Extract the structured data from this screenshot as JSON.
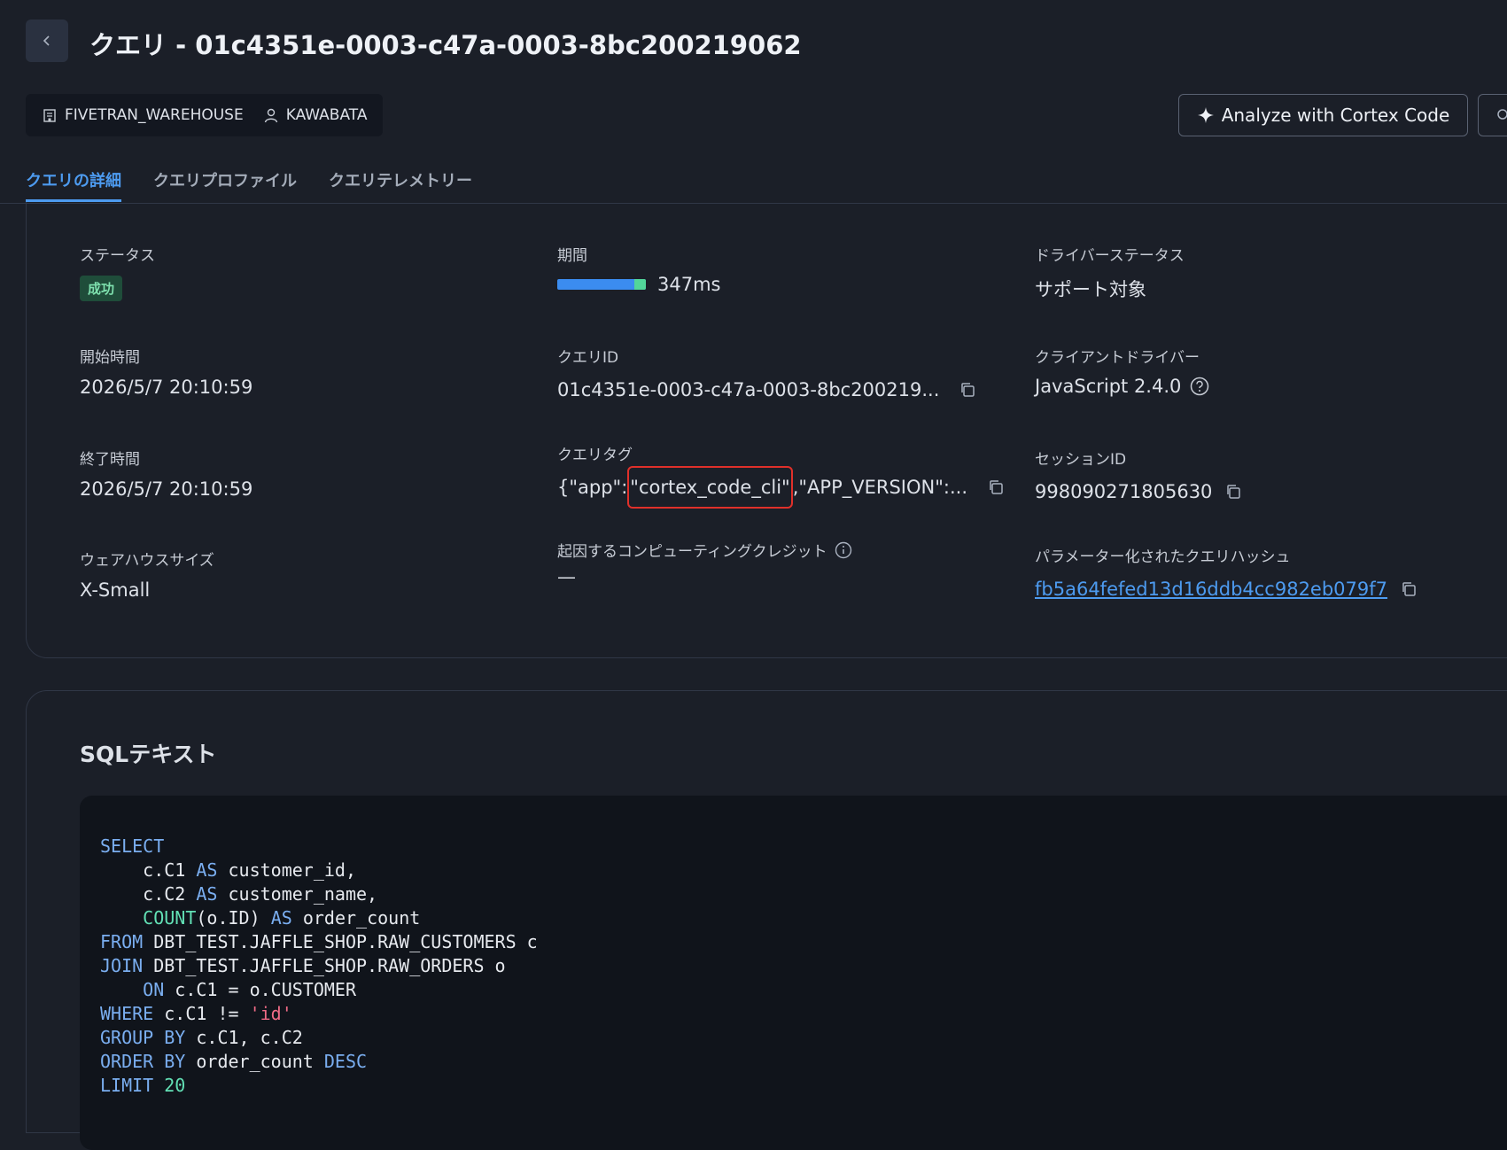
{
  "header": {
    "title": "クエリ - 01c4351e-0003-c47a-0003-8bc200219062",
    "warehouse": "FIVETRAN_WAREHOUSE",
    "user": "KAWABATA",
    "analyze_label": "Analyze with Cortex Code"
  },
  "tabs": [
    "クエリの詳細",
    "クエリプロファイル",
    "クエリテレメトリー"
  ],
  "details": {
    "status": {
      "label": "ステータス",
      "value": "成功"
    },
    "duration": {
      "label": "期間",
      "value": "347ms"
    },
    "driver_status": {
      "label": "ドライバーステータス",
      "value": "サポート対象"
    },
    "start_time": {
      "label": "開始時間",
      "value": "2026/5/7 20:10:59"
    },
    "query_id": {
      "label": "クエリID",
      "value": "01c4351e-0003-c47a-0003-8bc200219..."
    },
    "client_driver": {
      "label": "クライアントドライバー",
      "value": "JavaScript 2.4.0"
    },
    "end_time": {
      "label": "終了時間",
      "value": "2026/5/7 20:10:59"
    },
    "query_tag": {
      "label": "クエリタグ",
      "value_prefix": "{\"app\":",
      "value_highlight": "\"cortex_code_cli\"",
      "value_suffix": ",\"APP_VERSION\":..."
    },
    "session_id": {
      "label": "セッションID",
      "value": "998090271805630"
    },
    "warehouse_size": {
      "label": "ウェアハウスサイズ",
      "value": "X-Small"
    },
    "credits": {
      "label": "起因するコンピューティングクレジット",
      "value": "—"
    },
    "param_hash": {
      "label": "パラメーター化されたクエリハッシュ",
      "value": "fb5a64fefed13d16ddb4cc982eb079f7"
    }
  },
  "sql": {
    "title": "SQLテキスト",
    "lines": [
      [
        [
          "kw",
          "SELECT"
        ]
      ],
      [
        [
          "t",
          "    c.C1 "
        ],
        [
          "kw",
          "AS"
        ],
        [
          "t",
          " customer_id,"
        ]
      ],
      [
        [
          "t",
          "    c.C2 "
        ],
        [
          "kw",
          "AS"
        ],
        [
          "t",
          " customer_name,"
        ]
      ],
      [
        [
          "t",
          "    "
        ],
        [
          "fn",
          "COUNT"
        ],
        [
          "t",
          "(o.ID) "
        ],
        [
          "kw",
          "AS"
        ],
        [
          "t",
          " order_count"
        ]
      ],
      [
        [
          "kw",
          "FROM"
        ],
        [
          "t",
          " DBT_TEST.JAFFLE_SHOP.RAW_CUSTOMERS c"
        ]
      ],
      [
        [
          "kw",
          "JOIN"
        ],
        [
          "t",
          " DBT_TEST.JAFFLE_SHOP.RAW_ORDERS o"
        ]
      ],
      [
        [
          "t",
          "    "
        ],
        [
          "kw",
          "ON"
        ],
        [
          "t",
          " c.C1 = o.CUSTOMER"
        ]
      ],
      [
        [
          "kw",
          "WHERE"
        ],
        [
          "t",
          " c.C1 != "
        ],
        [
          "str",
          "'id'"
        ]
      ],
      [
        [
          "kw",
          "GROUP BY"
        ],
        [
          "t",
          " c.C1, c.C2"
        ]
      ],
      [
        [
          "kw",
          "ORDER BY"
        ],
        [
          "t",
          " order_count "
        ],
        [
          "kw",
          "DESC"
        ]
      ],
      [
        [
          "kw",
          "LIMIT"
        ],
        [
          "t",
          " "
        ],
        [
          "num",
          "20"
        ]
      ]
    ]
  },
  "icons": {
    "back": "chevron-left-icon",
    "warehouse": "building-icon",
    "user": "user-icon",
    "sparkle": "sparkle-icon",
    "copy": "copy-icon",
    "help": "question-circle-icon",
    "info": "info-circle-icon"
  },
  "colors": {
    "background": "#1b1f28",
    "accent": "#4d9bf0",
    "success_badge": "#1f4d3a",
    "highlight_box": "#e0302a"
  }
}
